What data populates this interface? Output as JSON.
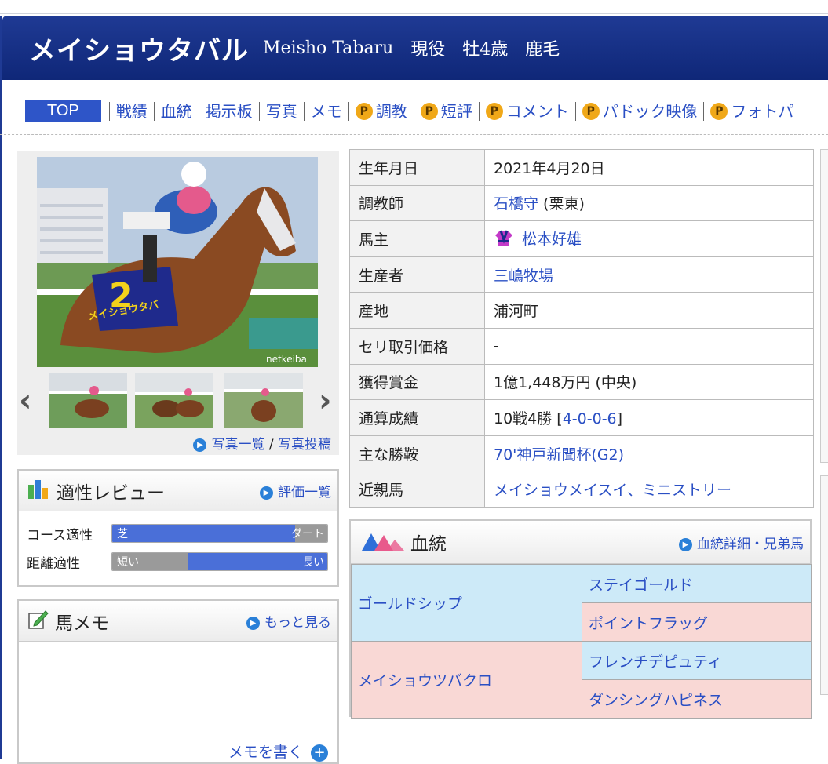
{
  "header": {
    "name": "メイショウタバル",
    "name_en": "Meisho Tabaru",
    "status": "現役",
    "sex_age": "牡4歳",
    "color": "鹿毛"
  },
  "tabs": [
    {
      "label": "TOP",
      "active": true,
      "premium": false
    },
    {
      "label": "戦績",
      "premium": false
    },
    {
      "label": "血統",
      "premium": false
    },
    {
      "label": "掲示板",
      "premium": false
    },
    {
      "label": "写真",
      "premium": false
    },
    {
      "label": "メモ",
      "premium": false
    },
    {
      "label": "調教",
      "premium": true
    },
    {
      "label": "短評",
      "premium": true
    },
    {
      "label": "コメント",
      "premium": true
    },
    {
      "label": "パドック映像",
      "premium": true
    },
    {
      "label": "フォトパ",
      "premium": true
    }
  ],
  "premium_badge": "P",
  "photo": {
    "watermark": "netkeiba",
    "saddle_number": "2",
    "saddle_name": "メイショウタバ",
    "prev_arrow": "‹",
    "next_arrow": "›",
    "list_link": "写真一覧",
    "separator": " / ",
    "post_link": "写真投稿"
  },
  "aptitude": {
    "title": "適性レビュー",
    "more": "評価一覧",
    "rows": [
      {
        "label": "コース適性",
        "left": "芝",
        "right": "ダート",
        "level": 0.85
      },
      {
        "label": "距離適性",
        "left": "短い",
        "right": "長い",
        "level": 0.35
      }
    ]
  },
  "memo": {
    "title": "馬メモ",
    "more": "もっと見る",
    "write": "メモを書く"
  },
  "info": {
    "rows": [
      {
        "key": "生年月日",
        "value": "2021年4月20日"
      },
      {
        "key": "調教師",
        "value": "石橋守",
        "value_suffix": " (栗東)",
        "link": true
      },
      {
        "key": "馬主",
        "value": "松本好雄",
        "link": true,
        "silks": true
      },
      {
        "key": "生産者",
        "value": "三嶋牧場",
        "link": true
      },
      {
        "key": "産地",
        "value": "浦河町"
      },
      {
        "key": "セリ取引価格",
        "value": "-"
      },
      {
        "key": "獲得賞金",
        "value": "1億1,448万円 (中央)"
      },
      {
        "key": "通算成績",
        "value_prefix": "10戦4勝 [",
        "value": "4-0-0-6",
        "value_suffix": "]",
        "link": true
      },
      {
        "key": "主な勝鞍",
        "value": "70'神戸新聞杯(G2)",
        "link": true
      },
      {
        "key": "近親馬",
        "value": "メイショウメイスイ、ミニストリー",
        "link": true
      }
    ]
  },
  "pedigree": {
    "title": "血統",
    "more": "血統詳細・兄弟馬",
    "sire": "ゴールドシップ",
    "sire_sire": "ステイゴールド",
    "sire_dam": "ポイントフラッグ",
    "dam": "メイショウツバクロ",
    "dam_sire": "フレンチデピュティ",
    "dam_dam": "ダンシングハピネス"
  }
}
